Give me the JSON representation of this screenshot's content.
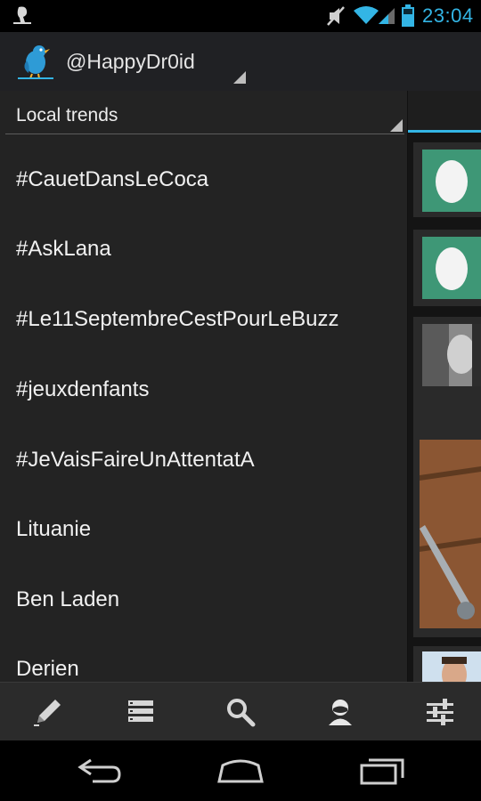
{
  "status_bar": {
    "time": "23:04",
    "icons": [
      "notification-app-icon",
      "vibrate-silent-icon",
      "wifi-icon",
      "cell-signal-icon",
      "battery-icon"
    ],
    "accent_color": "#33b5e5"
  },
  "action_bar": {
    "app_icon": "bird-icon",
    "account": "@HappyDr0id"
  },
  "drawer": {
    "spinner_label": "Local trends",
    "trends": [
      "#CauetDansLeCoca",
      "#AskLana",
      "#Le11SeptembreCestPourLeBuzz",
      "#jeuxdenfants",
      "#JeVaisFaireUnAttentatA",
      "Lituanie",
      "Ben Laden",
      "Derien"
    ]
  },
  "toolbar": {
    "items": [
      "compose-icon",
      "lists-icon",
      "search-icon",
      "profile-icon",
      "settings-icon"
    ]
  },
  "nav_bar": {
    "items": [
      "back-icon",
      "home-icon",
      "recent-apps-icon"
    ]
  }
}
